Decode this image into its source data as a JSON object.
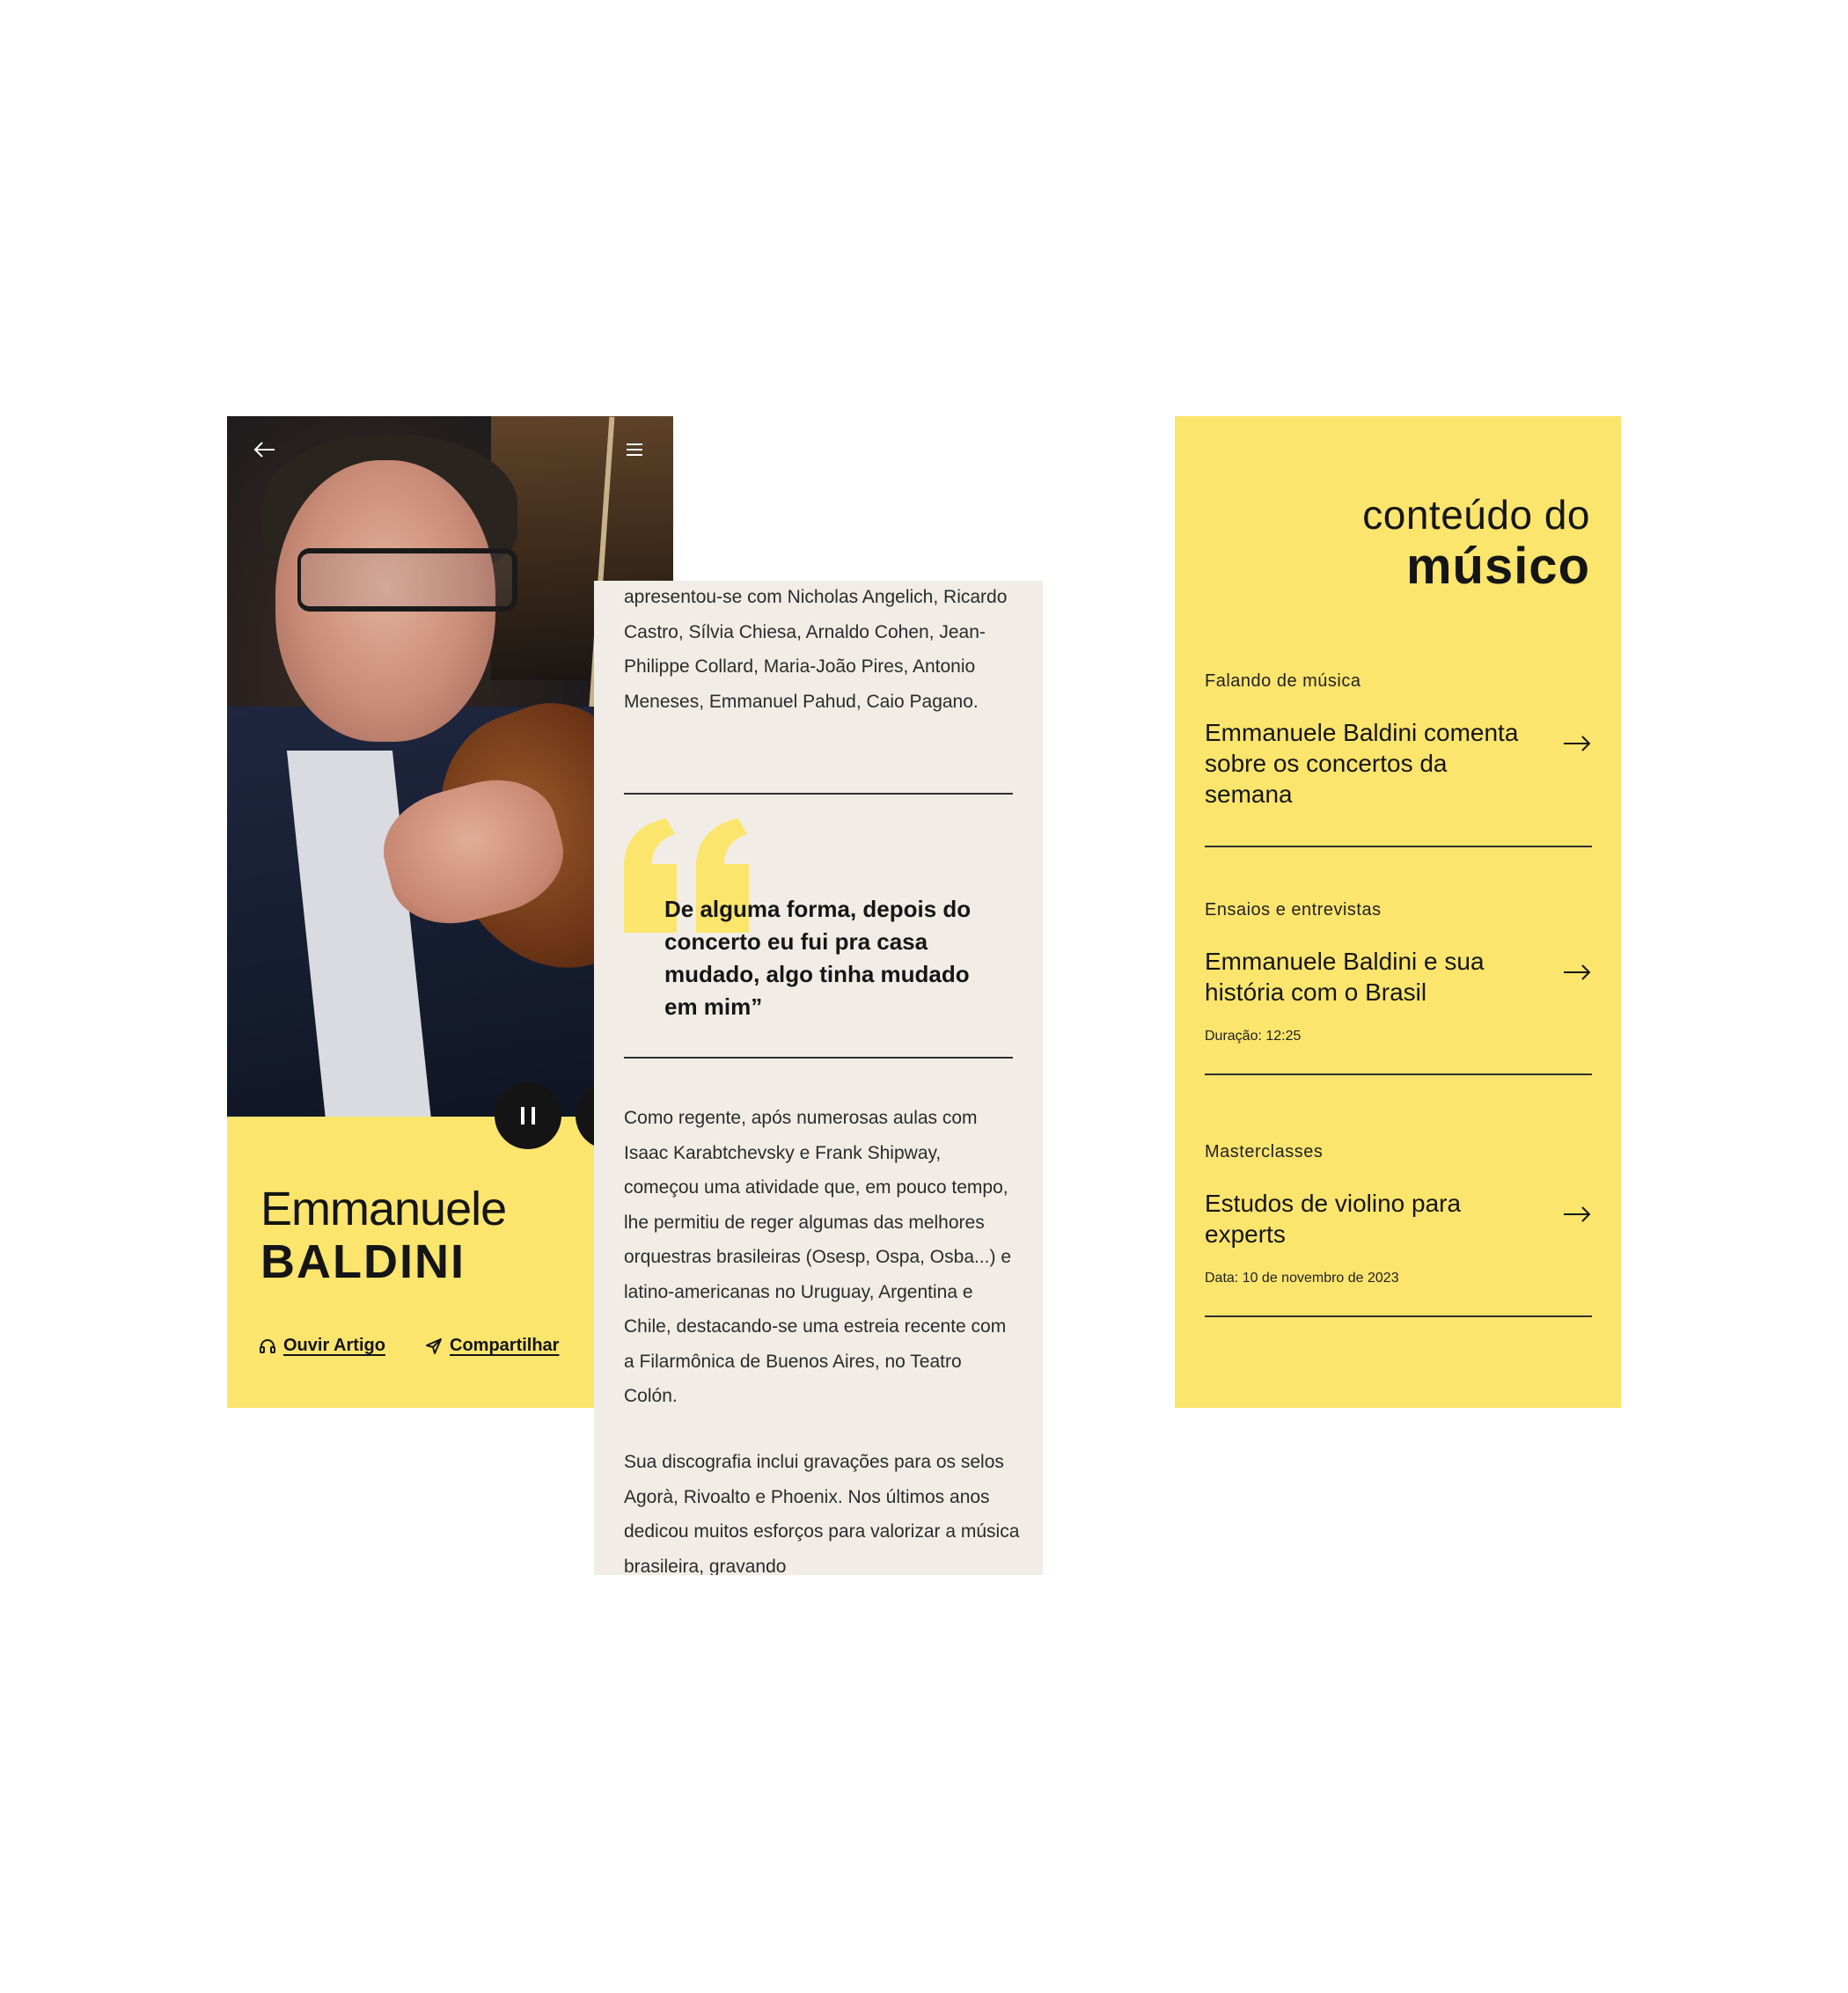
{
  "colors": {
    "accent_yellow": "#fbe56d",
    "paper": "#f1ede6",
    "ink": "#151515"
  },
  "screen1": {
    "icons": {
      "back": "arrow-left-icon",
      "menu": "hamburger-menu-icon",
      "pause": "pause-icon",
      "headphones": "headphones-icon",
      "share": "paper-plane-icon"
    },
    "artist_first_name": "Emmanuele",
    "artist_last_name": "BALDINI",
    "actions": {
      "listen": "Ouvir Artigo",
      "share": "Compartilhar"
    }
  },
  "screen2": {
    "para_top": "apresentou-se com Nicholas Angelich, Ricardo Castro, Sílvia Chiesa, Arnaldo Cohen, Jean-Philippe Collard, Maria-João Pires, Antonio Meneses, Emmanuel Pahud, Caio Pagano.",
    "quote": "De alguma forma, depois do concerto eu fui pra casa mudado, algo tinha mudado em mim”",
    "para_mid": "Como regente, após numerosas aulas com Isaac Karabtchevsky e Frank Shipway, começou uma atividade que, em pouco tempo, lhe permitiu de reger algumas das melhores orquestras brasileiras (Osesp, Ospa, Osba...) e latino-americanas no Uruguay, Argentina e Chile, destacando-se uma estreia recente com a Filarmônica de Buenos Aires, no Teatro Colón.",
    "para_bottom": "Sua discografia inclui gravações para os selos Agorà, Rivoalto e Phoenix. Nos últimos anos dedicou muitos esforços para valorizar a música brasileira, gravando"
  },
  "screen3": {
    "title_line1": "conteúdo do",
    "title_line2": "músico",
    "items": [
      {
        "category": "Falando de música",
        "title": "Emmanuele Baldini comenta sobre os concertos da semana",
        "meta": ""
      },
      {
        "category": "Ensaios e entrevistas",
        "title": "Emmanuele Baldini e sua história com o Brasil",
        "meta": "Duração: 12:25"
      },
      {
        "category": "Masterclasses",
        "title": "Estudos de violino para experts",
        "meta": "Data: 10 de novembro de 2023"
      }
    ]
  }
}
